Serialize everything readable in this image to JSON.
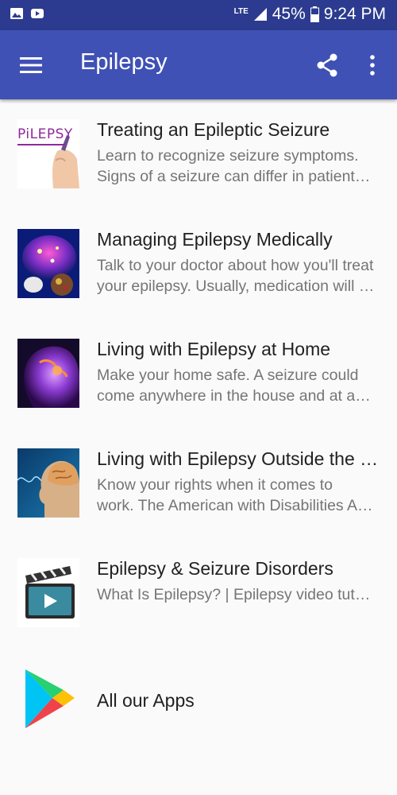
{
  "status_bar": {
    "network": "LTE",
    "battery": "45%",
    "time": "9:24 PM"
  },
  "app_bar": {
    "title": "Epilepsy"
  },
  "items": [
    {
      "title": "Treating an Epileptic Seizure",
      "desc_line1": "Learn to recognize seizure symptoms.",
      "desc_line2": "Signs of a seizure can differ in patients …",
      "thumb_text": "PiLEPSY"
    },
    {
      "title": "Managing Epilepsy Medically",
      "desc_line1": "Talk to your doctor about how you'll treat",
      "desc_line2": "your epilepsy. Usually, medication will b…"
    },
    {
      "title": "Living with Epilepsy at Home",
      "desc_line1": "Make your home safe. A seizure could",
      "desc_line2": "come anywhere in the house and at any…"
    },
    {
      "title": "Living with Epilepsy Outside the H…",
      "desc_line1": "Know your rights when it comes to",
      "desc_line2": "work. The American with Disabilities Ac…"
    },
    {
      "title": "Epilepsy & Seizure Disorders",
      "desc_line1": "What Is Epilepsy? | Epilepsy video tutos r",
      "desc_line2": ""
    }
  ],
  "all_apps": {
    "label": "All our Apps"
  },
  "colors": {
    "status_bar": "#2c3b8f",
    "app_bar": "#3f51b5",
    "background": "#fafafa"
  }
}
